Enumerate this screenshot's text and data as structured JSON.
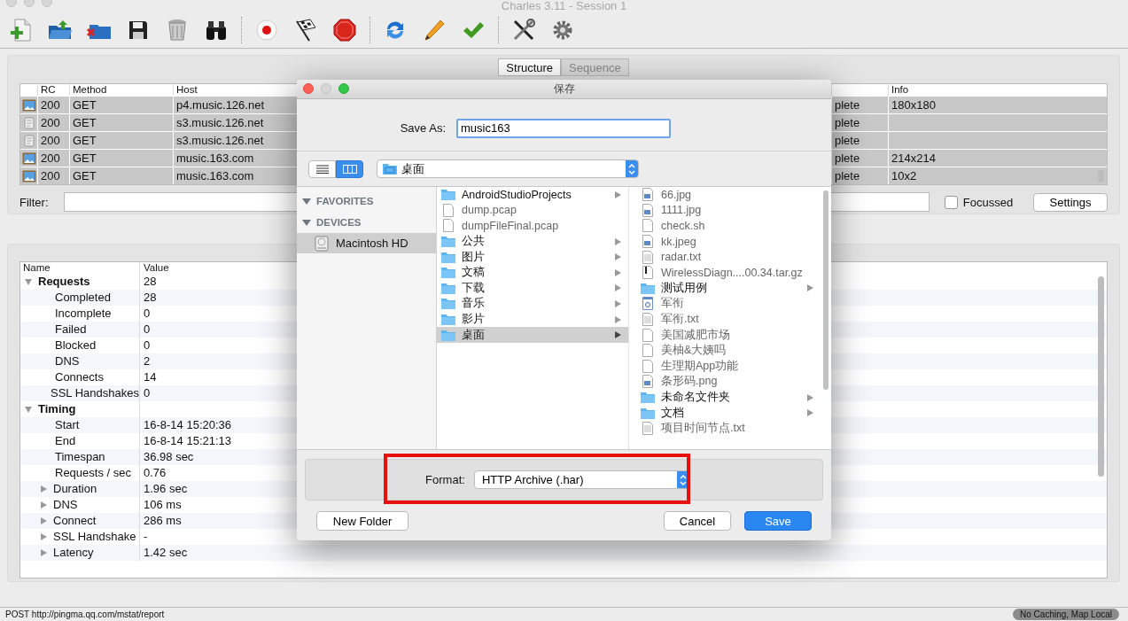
{
  "window": {
    "title": "Charles 3.11 - Session 1"
  },
  "view_tabs": [
    {
      "label": "Structure",
      "selected": true
    },
    {
      "label": "Sequence",
      "selected": false
    }
  ],
  "requests_table": {
    "columns": [
      "RC",
      "Method",
      "Host",
      "Info"
    ],
    "rows": [
      {
        "kind": "image",
        "selected": true,
        "rc": "200",
        "method": "GET",
        "host": "p4.music.126.net",
        "column_status": "plete",
        "info": "180x180"
      },
      {
        "kind": "script",
        "selected": true,
        "rc": "200",
        "method": "GET",
        "host": "s3.music.126.net",
        "column_status": "plete"
      },
      {
        "kind": "script",
        "selected": true,
        "rc": "200",
        "method": "GET",
        "host": "s3.music.126.net",
        "column_status": "plete"
      },
      {
        "kind": "image",
        "selected": true,
        "rc": "200",
        "method": "GET",
        "host": "music.163.com",
        "column_status": "plete",
        "info": "214x214"
      },
      {
        "kind": "image",
        "selected": true,
        "rc": "200",
        "method": "GET",
        "host": "music.163.com",
        "column_status": "plete",
        "info": "10x2"
      }
    ]
  },
  "filter": {
    "label": "Filter:",
    "focussed": {
      "label": "Focussed",
      "checked": false
    },
    "settings_button": "Settings"
  },
  "overview": {
    "columns": [
      "Name",
      "Value"
    ],
    "rows": [
      {
        "name": "Requests",
        "value": "28",
        "expanded": true,
        "children": [
          {
            "name": "Completed",
            "value": "28"
          },
          {
            "name": "Incomplete",
            "value": "0"
          },
          {
            "name": "Failed",
            "value": "0"
          },
          {
            "name": "Blocked",
            "value": "0"
          },
          {
            "name": "DNS",
            "value": "2"
          },
          {
            "name": "Connects",
            "value": "14"
          },
          {
            "name": "SSL Handshakes",
            "value": "0"
          }
        ]
      },
      {
        "name": "Timing",
        "expanded": true,
        "children": [
          {
            "name": "Start",
            "value": "16-8-14 15:20:36"
          },
          {
            "name": "End",
            "value": "16-8-14 15:21:13"
          },
          {
            "name": "Timespan",
            "value": "36.98 sec"
          },
          {
            "name": "Requests / sec",
            "value": "0.76"
          },
          {
            "name": "Duration",
            "value": "1.96 sec",
            "expanded": false
          },
          {
            "name": "DNS",
            "value": "106 ms",
            "expanded": false
          },
          {
            "name": "Connect",
            "value": "286 ms",
            "expanded": false
          },
          {
            "name": "SSL Handshake",
            "value": "-",
            "expanded": false
          },
          {
            "name": "Latency",
            "value": "1.42 sec",
            "expanded": false
          }
        ]
      }
    ]
  },
  "status_bar": {
    "text": "POST http://pingma.qq.com/mstat/report",
    "badge": "No Caching, Map Local"
  },
  "dialog": {
    "title": "保存",
    "save_as": {
      "label": "Save As:",
      "value": "music163"
    },
    "view_buttons": [
      {
        "kind": "list",
        "selected": false
      },
      {
        "kind": "columns",
        "selected": true
      }
    ],
    "location": "桌面",
    "sidebar": [
      {
        "heading": "FAVORITES",
        "expanded": true
      },
      {
        "heading": "DEVICES",
        "expanded": true,
        "items": [
          {
            "label": "Macintosh HD",
            "selected": true
          }
        ]
      }
    ],
    "column_1": [
      {
        "name": "AndroidStudioProjects",
        "kind": "folder",
        "selected": false
      },
      {
        "name": "dump.pcap",
        "kind": "file",
        "selected": false
      },
      {
        "name": "dumpFileFinal.pcap",
        "kind": "file",
        "selected": false
      },
      {
        "name": "公共",
        "kind": "folder",
        "selected": false
      },
      {
        "name": "图片",
        "kind": "folder",
        "selected": false
      },
      {
        "name": "文稿",
        "kind": "folder",
        "selected": false
      },
      {
        "name": "下载",
        "kind": "folder",
        "selected": false
      },
      {
        "name": "音乐",
        "kind": "folder",
        "selected": false
      },
      {
        "name": "影片",
        "kind": "folder",
        "selected": false
      },
      {
        "name": "桌面",
        "kind": "folder",
        "selected": true
      }
    ],
    "column_2": [
      {
        "name": "66.jpg",
        "kind": "image",
        "selected": false
      },
      {
        "name": "1111.jpg",
        "kind": "image",
        "selected": false
      },
      {
        "name": "check.sh",
        "kind": "file",
        "selected": false
      },
      {
        "name": "kk.jpeg",
        "kind": "image",
        "selected": false
      },
      {
        "name": "radar.txt",
        "kind": "text",
        "selected": false
      },
      {
        "name": "WirelessDiagn....00.34.tar.gz",
        "kind": "archive",
        "selected": false
      },
      {
        "name": "测试用例",
        "kind": "folder",
        "selected": false
      },
      {
        "name": "军衔",
        "kind": "document",
        "selected": false
      },
      {
        "name": "军衔.txt",
        "kind": "text",
        "selected": false
      },
      {
        "name": "美国减肥市场",
        "kind": "file",
        "selected": false
      },
      {
        "name": "美柚&大姨吗",
        "kind": "file",
        "selected": false
      },
      {
        "name": "生理期App功能",
        "kind": "file",
        "selected": false
      },
      {
        "name": "条形码.png",
        "kind": "image",
        "selected": false
      },
      {
        "name": "未命名文件夹",
        "kind": "folder",
        "selected": false
      },
      {
        "name": "文档",
        "kind": "folder",
        "selected": false
      },
      {
        "name": "项目时间节点.txt",
        "kind": "text",
        "selected": false
      }
    ],
    "format": {
      "label": "Format:",
      "value": "HTTP Archive (.har)",
      "highlighted": true
    },
    "buttons": [
      {
        "label": "New Folder",
        "kind": "normal"
      },
      {
        "label": "Cancel",
        "kind": "normal"
      },
      {
        "label": "Save",
        "kind": "default"
      }
    ]
  }
}
